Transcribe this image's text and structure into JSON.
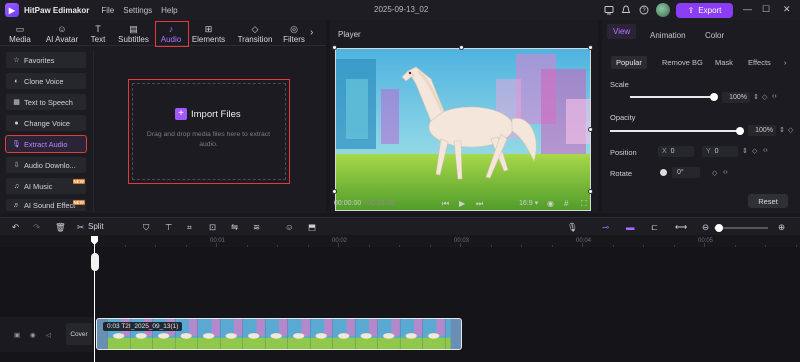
{
  "titlebar": {
    "app_name": "HitPaw Edimakor",
    "menus": [
      "File",
      "Settings",
      "Help"
    ],
    "doc_title": "2025-09-13_02",
    "export_label": "Export"
  },
  "categories": [
    {
      "label": "Media",
      "icon": "folder-icon"
    },
    {
      "label": "AI Avatar",
      "icon": "avatar-icon"
    },
    {
      "label": "Text",
      "icon": "text-icon"
    },
    {
      "label": "Subtitles",
      "icon": "subtitles-icon"
    },
    {
      "label": "Audio",
      "icon": "music-note-icon",
      "active": true
    },
    {
      "label": "Elements",
      "icon": "elements-icon"
    },
    {
      "label": "Transition",
      "icon": "transition-icon"
    },
    {
      "label": "Filters",
      "icon": "filters-icon"
    }
  ],
  "audio_nav": [
    {
      "label": "Favorites",
      "icon": "star-icon"
    },
    {
      "label": "Clone Voice",
      "icon": "voice-icon"
    },
    {
      "label": "Text to Speech",
      "icon": "tts-icon"
    },
    {
      "label": "Change Voice",
      "icon": "change-voice-icon"
    },
    {
      "label": "Extract Audio",
      "icon": "microphone-icon",
      "active": true
    },
    {
      "label": "Audio Downlo...",
      "icon": "download-icon"
    },
    {
      "label": "AI Music",
      "icon": "ai-music-icon",
      "badge": "NEW"
    },
    {
      "label": "AI Sound Effect",
      "icon": "sound-effect-icon",
      "badge": "NEW"
    }
  ],
  "import": {
    "button_label": "Import Files",
    "hint": "Drag and drop media files here to extract audio."
  },
  "player": {
    "title": "Player",
    "current_time": "00:00:00",
    "total_time": "/ 00:03:00",
    "aspect_ratio": "16:9"
  },
  "properties": {
    "tabs": [
      "View",
      "Animation",
      "Color"
    ],
    "subtabs": [
      "Popular",
      "Remove BG",
      "Mask",
      "Effects"
    ],
    "scale_label": "Scale",
    "scale_value": "100%",
    "scale_level": 1.0,
    "opacity_label": "Opacity",
    "opacity_value": "100%",
    "opacity_level": 1.0,
    "position_label": "Position",
    "pos_x_label": "X",
    "pos_x_value": "0",
    "pos_y_label": "Y",
    "pos_y_value": "0",
    "rotate_label": "Rotate",
    "rotate_value": "0°",
    "reset_label": "Reset"
  },
  "timeline": {
    "split_label": "Split",
    "ruler_labels": [
      "0:00",
      "00:01",
      "00:02",
      "00:03",
      "00:04",
      "00:05"
    ],
    "cover_label": "Cover",
    "clip_label": "0:03 T2I_2025_09_13(1)"
  },
  "colors": {
    "accent": "#8b3cf5",
    "highlight_outline": "#e23b3b",
    "active_text": "#b575ff"
  }
}
